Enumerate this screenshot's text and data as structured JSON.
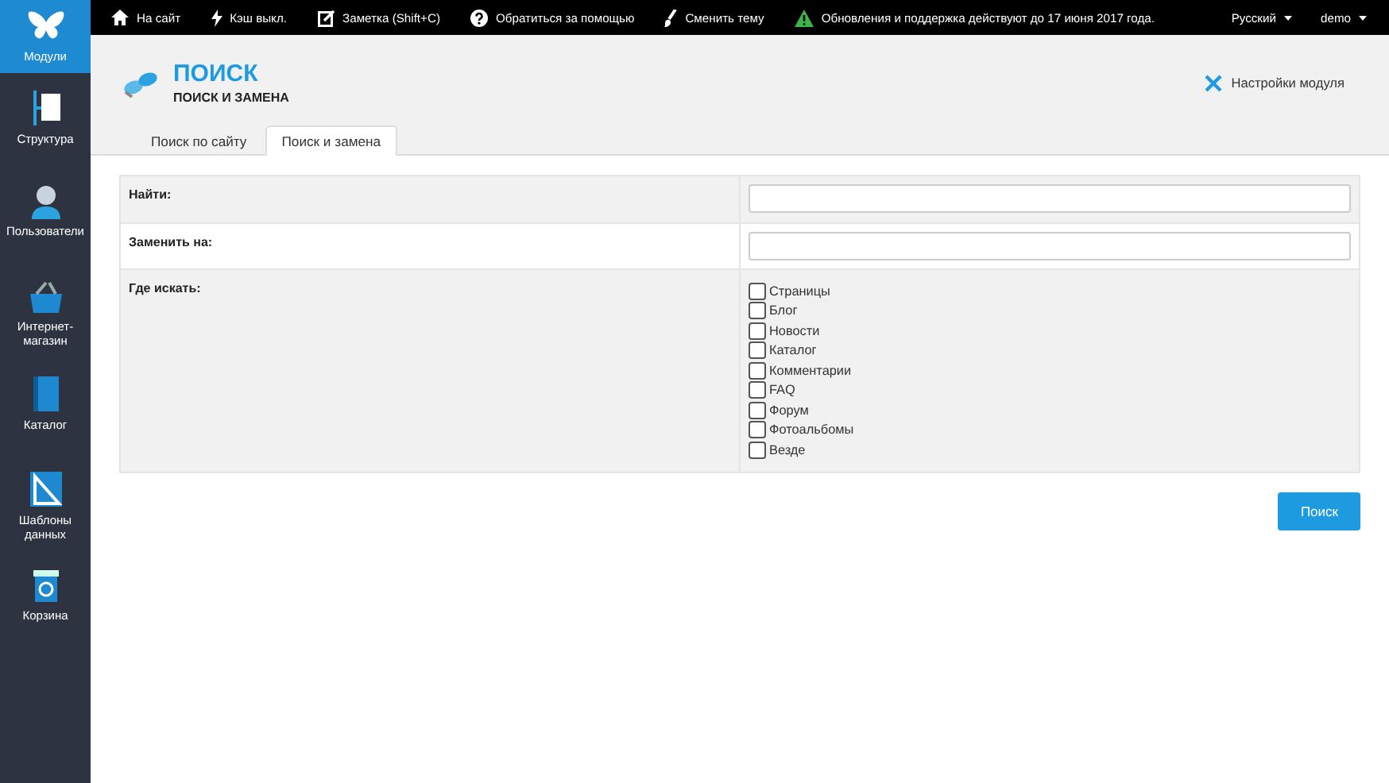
{
  "sidebar": {
    "items": [
      {
        "label": "Модули",
        "kind": "butterfly",
        "selected": true
      },
      {
        "label": "Структура",
        "kind": "structure",
        "selected": false
      },
      {
        "label": "Пользователи",
        "kind": "user",
        "selected": false
      },
      {
        "label": "Интернет-магазин",
        "kind": "basket",
        "selected": false
      },
      {
        "label": "Каталог",
        "kind": "book",
        "selected": false
      },
      {
        "label": "Шаблоны данных",
        "kind": "ruler",
        "selected": false
      },
      {
        "label": "Корзина",
        "kind": "trash",
        "selected": false
      }
    ]
  },
  "topbar": {
    "items": [
      {
        "label": "На сайт",
        "kind": "home"
      },
      {
        "label": "Кэш выкл.",
        "kind": "bolt"
      },
      {
        "label": "Заметка (Shift+C)",
        "kind": "edit"
      },
      {
        "label": "Обратиться за помощью",
        "kind": "help"
      },
      {
        "label": "Сменить тему",
        "kind": "brush"
      },
      {
        "label": "Обновления и поддержка действуют до 17 июня 2017 года.",
        "kind": "warning"
      }
    ],
    "menus": [
      "Русский",
      "demo"
    ]
  },
  "header": {
    "title": "ПОИСК",
    "subtitle": "ПОИСК И ЗАМЕНА",
    "settings_link": "Настройки модуля"
  },
  "tabs": [
    {
      "label": "Поиск по сайту",
      "selected": false
    },
    {
      "label": "Поиск и замена",
      "selected": true
    }
  ],
  "form": {
    "find_label": "Найти:",
    "replace_label": "Заменить на:",
    "where_label": "Где искать:",
    "options": [
      {
        "label": "Страницы",
        "checked": false
      },
      {
        "label": "Блог",
        "checked": false
      },
      {
        "label": "Новости",
        "checked": false
      },
      {
        "label": "Каталог",
        "checked": false
      },
      {
        "label": "Комментарии",
        "checked": false
      },
      {
        "label": "FAQ",
        "checked": false
      },
      {
        "label": "Форум",
        "checked": false
      },
      {
        "label": "Фотоальбомы",
        "checked": false
      },
      {
        "label": "Везде",
        "checked": false
      }
    ]
  },
  "search_button": "Поиск"
}
